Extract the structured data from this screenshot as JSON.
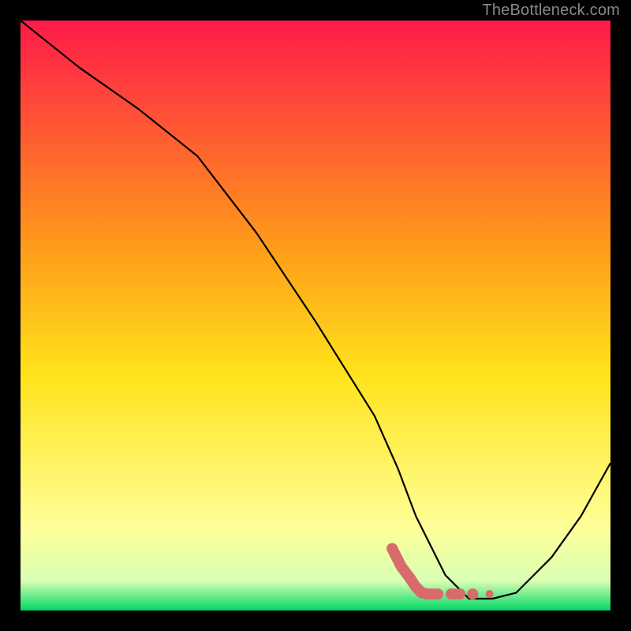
{
  "watermark": "TheBottleneck.com",
  "colors": {
    "gradient_top": "#ff1a4a",
    "gradient_mid1": "#ff9a1a",
    "gradient_mid2": "#ffe31a",
    "gradient_mid3": "#ffff99",
    "gradient_bottom": "#00d865",
    "line": "#000000",
    "marker": "#d96b6b",
    "background": "#000000"
  },
  "chart_data": {
    "type": "line",
    "title": "",
    "xlabel": "",
    "ylabel": "",
    "xlim": [
      0,
      100
    ],
    "ylim": [
      0,
      100
    ],
    "series": [
      {
        "name": "curve",
        "x": [
          0,
          10,
          20,
          30,
          40,
          50,
          60,
          64,
          67,
          72,
          76,
          78,
          80,
          84,
          90,
          95,
          100
        ],
        "values": [
          100,
          92,
          85,
          77,
          64,
          49,
          33,
          24,
          16,
          6,
          2,
          2,
          2,
          3,
          9,
          16,
          25
        ]
      }
    ],
    "markers": {
      "name": "highlight",
      "x": [
        63,
        64.5,
        66,
        67,
        68,
        69,
        70,
        73,
        74.5,
        79.5
      ],
      "values": [
        10.5,
        7.5,
        5.5,
        4.0,
        3.0,
        2.8,
        2.8,
        2.8,
        2.8,
        2.8
      ]
    }
  }
}
